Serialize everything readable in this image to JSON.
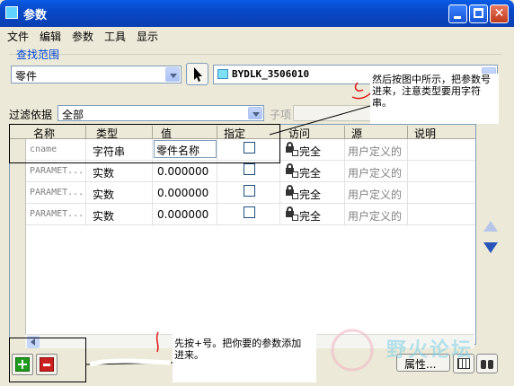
{
  "window": {
    "title": "参数"
  },
  "menu": {
    "items": [
      "文件",
      "编辑",
      "参数",
      "工具",
      "显示"
    ]
  },
  "scope": {
    "group_label": "查找范围",
    "type_value": "零件",
    "model_value": "BYDLK_3506010"
  },
  "filter": {
    "label": "过滤依据",
    "value": "全部",
    "sub_label": "子项"
  },
  "table": {
    "columns": [
      "名称",
      "类型",
      "值",
      "指定",
      "访问",
      "源",
      "说明"
    ],
    "rows": [
      {
        "name": "cname",
        "type": "字符串",
        "value": "零件名称",
        "designate": false,
        "access": "完全",
        "source": "用户定义的",
        "note": ""
      },
      {
        "name": "PARAMET...",
        "type": "实数",
        "value": "0.000000",
        "designate": false,
        "access": "完全",
        "source": "用户定义的",
        "note": ""
      },
      {
        "name": "PARAMET...",
        "type": "实数",
        "value": "0.000000",
        "designate": false,
        "access": "完全",
        "source": "用户定义的",
        "note": ""
      },
      {
        "name": "PARAMET...",
        "type": "实数",
        "value": "0.000000",
        "designate": false,
        "access": "完全",
        "source": "用户定义的",
        "note": ""
      }
    ]
  },
  "bottom": {
    "properties_label": "属性..."
  },
  "annotations": {
    "top_note": "然后按图中所示，把参数号进来，注意类型要用字符串。",
    "bottom_note": "先按+号。把你要的参数添加进来。"
  },
  "watermark": "野火论坛",
  "icons": {
    "app": "window-app-icon",
    "pointer": "cursor-arrow-icon",
    "model": "part-model-icon",
    "access": "lock-network-icon",
    "add": "plus-icon",
    "remove": "minus-icon",
    "grid": "table-grid-icon",
    "find": "binoculars-icon"
  },
  "colors": {
    "title_bar": "#0a5ce6",
    "group_label": "#0046d5",
    "add": "#1f9c1f",
    "remove": "#cc1f1f"
  }
}
